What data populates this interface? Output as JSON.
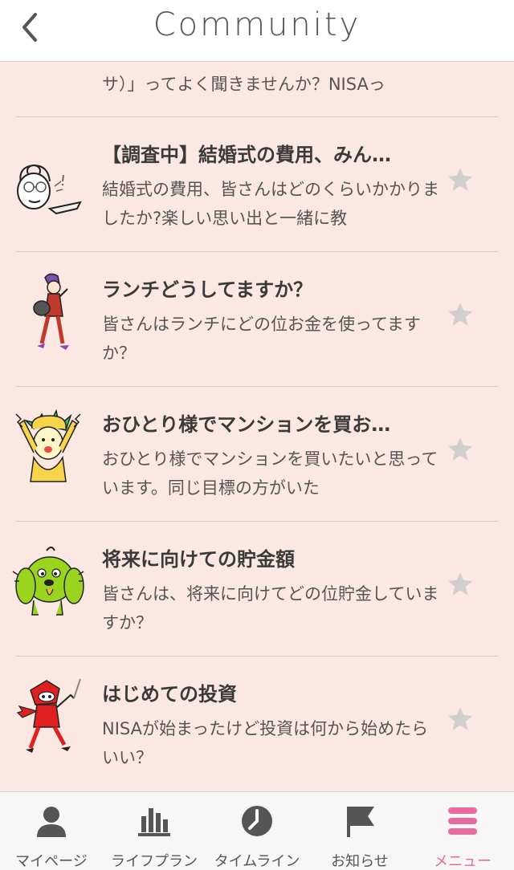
{
  "header": {
    "title": "Community"
  },
  "partial_item": {
    "body_tail": "サ）」ってよく聞きませんか？NISAっ"
  },
  "items": [
    {
      "title": "【調査中】結婚式の費用、みん…",
      "body": "結婚式の費用、皆さんはどのくらいかかりましたか?楽しい思い出と一緒に教",
      "avatar_icon": "woman-with-glasses-pointing-icon"
    },
    {
      "title": "ランチどうしてますか？",
      "body": "皆さんはランチにどの位お金を使ってますか？",
      "avatar_icon": "walking-woman-with-bag-icon"
    },
    {
      "title": "おひとり様でマンションを買お…",
      "body": "おひとり様でマンションを買いたいと思っています。同じ目標の方がいた",
      "avatar_icon": "surprised-person-hands-up-icon"
    },
    {
      "title": "将来に向けての貯金額",
      "body": "皆さんは、将来に向けてどの位貯金していますか？",
      "avatar_icon": "green-dog-icon"
    },
    {
      "title": "はじめての投資",
      "body": "NISAが始まったけど投資は何から始めたらいい？",
      "avatar_icon": "red-ninja-icon"
    }
  ],
  "tabbar": {
    "tabs": [
      {
        "label": "マイページ",
        "icon": "person-icon"
      },
      {
        "label": "ライフプラン",
        "icon": "bar-chart-icon"
      },
      {
        "label": "タイムライン",
        "icon": "clock-icon"
      },
      {
        "label": "お知らせ",
        "icon": "flag-icon"
      },
      {
        "label": "メニュー",
        "icon": "menu-icon"
      }
    ],
    "active_index": 4
  },
  "colors": {
    "background": "#fce8e2",
    "accent": "#e86aa0",
    "star": "#cfcfcf"
  }
}
